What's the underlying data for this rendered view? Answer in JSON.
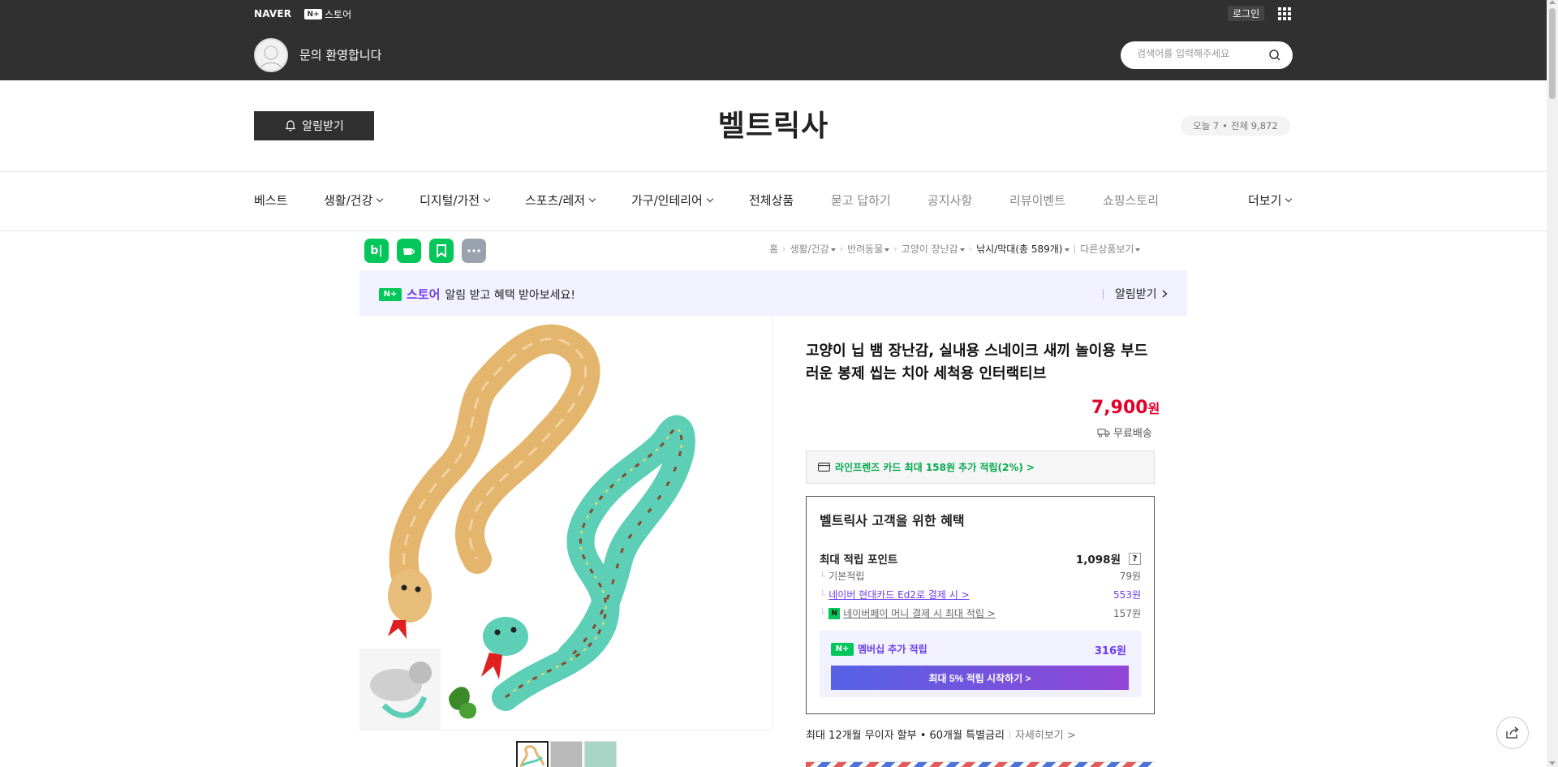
{
  "topbar": {
    "naver": "NAVER",
    "nplus_store": "스토어",
    "nplus_badge": "N+",
    "login": "로그인",
    "welcome": "문의 환영합니다",
    "search_placeholder": "검색어를 입력해주세요"
  },
  "header": {
    "alert_button": "알림받기",
    "store_name": "벨트릭사",
    "visitors_today": "오늘 7",
    "visitors_dot": "•",
    "visitors_total": "전체 9,872"
  },
  "nav": {
    "items": [
      {
        "label": "베스트",
        "dropdown": false
      },
      {
        "label": "생활/건강",
        "dropdown": true
      },
      {
        "label": "디지털/가전",
        "dropdown": true
      },
      {
        "label": "스포츠/레저",
        "dropdown": true
      },
      {
        "label": "가구/인테리어",
        "dropdown": true
      },
      {
        "label": "전체상품",
        "dropdown": false
      },
      {
        "label": "묻고 답하기",
        "dropdown": false
      },
      {
        "label": "공지사항",
        "dropdown": false
      },
      {
        "label": "리뷰이벤트",
        "dropdown": false
      },
      {
        "label": "쇼핑스토리",
        "dropdown": false
      }
    ],
    "more": "더보기"
  },
  "quick_icons": [
    "blog-icon",
    "cafe-icon",
    "bookmark-icon",
    "more-icon"
  ],
  "quick_icon_text": {
    "blog": "b|"
  },
  "breadcrumb": {
    "items": [
      "홈",
      "생활/건강",
      "반려동물",
      "고양이 장난감",
      "낚시/막대(총 589개)",
      "다른상품보기"
    ]
  },
  "promo": {
    "badge": "N+",
    "store_word": "스토어",
    "text": "알림 받고 혜택 받아보세요!",
    "action": "알림받기"
  },
  "product": {
    "title": "고양이 닙 뱀 장난감, 실내용 스네이크 새끼 놀이용 부드러운 봉제 씹는 치아 세척용 인터랙티브",
    "price": "7,900",
    "currency": "원",
    "shipping": "무료배송",
    "card_offer": "라인프렌즈 카드 최대 158원 추가 적립(2%) >"
  },
  "benefit": {
    "title": "벨트릭사 고객을 위한 혜택",
    "max_points_label": "최대 적립 포인트",
    "max_points_value": "1,098원",
    "qmark": "?",
    "rows": [
      {
        "label": "기본적립",
        "value": "79원"
      },
      {
        "label": "네이버 현대카드 Ed2로 결제 시 >",
        "value": "553원"
      },
      {
        "label": "네이버페이 머니 결제 시 최대 적립 >",
        "value": "157원"
      }
    ],
    "npay_badge": "N",
    "membership_label": "멤버십 추가 적립",
    "membership_value": "316원",
    "membership_button": "최대 5% 적립 시작하기 >"
  },
  "installment": {
    "text": "최대 12개월 무이자 할부 • 60개월 특별금리",
    "more": "자세히보기 >"
  },
  "colors": {
    "topbar": "#303030",
    "accent_purple": "#6b3ded",
    "naver_green": "#03c75a",
    "price_red": "#e4002b"
  }
}
